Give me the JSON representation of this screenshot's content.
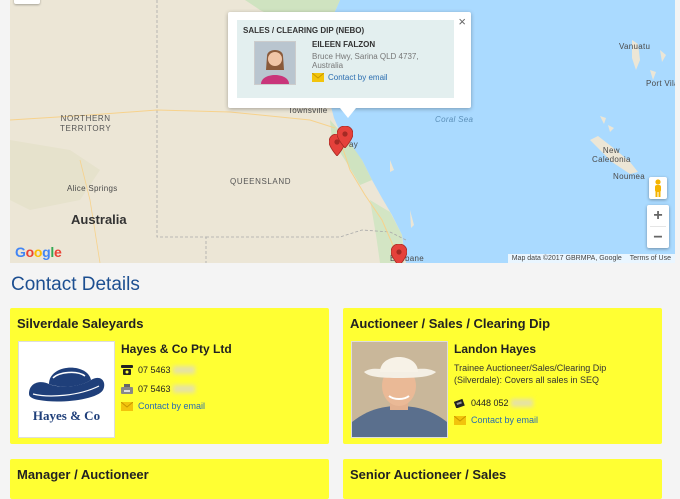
{
  "map": {
    "labels": {
      "northern_territory": "NORTHERN\nTERRITORY",
      "queensland": "QUEENSLAND",
      "australia": "Australia",
      "alice_springs": "Alice Springs",
      "townsville": "Townsville",
      "coral_sea": "Coral Sea",
      "vanuatu": "Vanuatu",
      "port_vila": "Port Vila",
      "new_caledonia": "New\nCaledonia",
      "noumea": "Noumea",
      "brisbane": "Brisbane",
      "mackay": "ay"
    },
    "google_logo": "Google",
    "footer": {
      "data": "Map data ©2017 GBRMPA, Google",
      "terms": "Terms of Use"
    },
    "zoom_in": "+",
    "zoom_out": "−",
    "info_window": {
      "title": "SALES / CLEARING DIP (NEBO)",
      "name": "EILEEN FALZON",
      "address": "Bruce Hwy, Sarina QLD 4737, Australia",
      "email_label": "Contact by email",
      "close": "×"
    }
  },
  "section": {
    "title": "Contact Details"
  },
  "cards": [
    {
      "title": "Silverdale Saleyards",
      "name": "Hayes & Co Pty Ltd",
      "logo_text": "Hayes & Co",
      "phone": "07 5463",
      "fax": "07 5463",
      "email_label": "Contact by email"
    },
    {
      "title": "Auctioneer / Sales / Clearing Dip",
      "name": "Landon Hayes",
      "description": "Trainee Auctioneer/Sales/Clearing Dip (Silverdale): Covers all sales in SEQ",
      "mobile": "0448 052",
      "email_label": "Contact by email"
    },
    {
      "title": "Manager / Auctioneer"
    },
    {
      "title": "Senior Auctioneer / Sales"
    }
  ],
  "colors": {
    "card_bg": "#ffff33",
    "link": "#2a6db0",
    "heading": "#1d4f91",
    "water": "#aadaff",
    "land": "#efe9dc"
  }
}
